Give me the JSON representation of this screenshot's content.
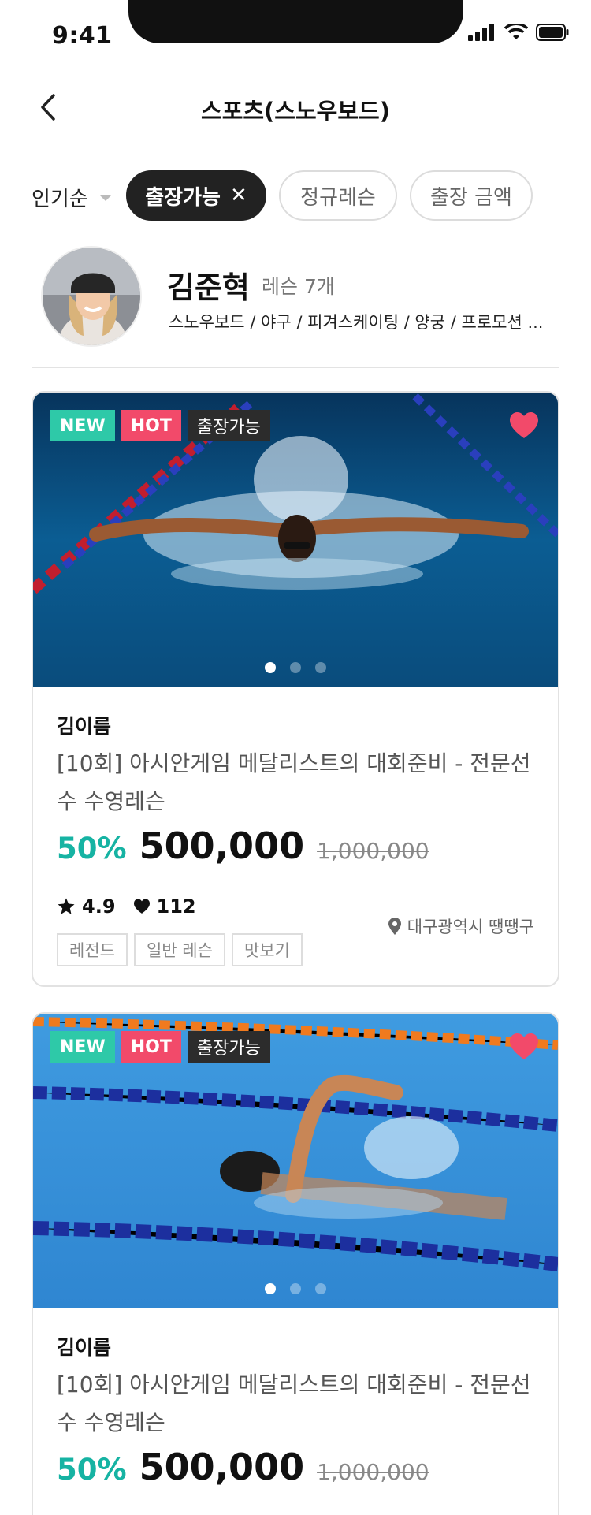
{
  "status": {
    "time": "9:41"
  },
  "header": {
    "title": "스포츠(스노우보드)"
  },
  "filters": {
    "sort_label": "인기순",
    "chips": [
      {
        "label": "출장가능",
        "active": true,
        "close": "✕"
      },
      {
        "label": "정규레슨",
        "active": false
      },
      {
        "label": "출장 금액",
        "active": false
      }
    ]
  },
  "profile": {
    "name": "김준혁",
    "lesson_count": "레슨 7개",
    "sports": "스노우보드 / 야구 / 피겨스케이팅 / 양궁 / 프로모션 ..."
  },
  "cards": [
    {
      "badges": [
        "NEW",
        "HOT",
        "출장가능"
      ],
      "favorited": true,
      "instructor": "김이름",
      "title": "[10회]  아시안게임 메달리스트의 대회준비 - 전문선수 수영레슨",
      "discount": "50%",
      "price": "500,000",
      "original_price": "1,000,000",
      "rating": "4.9",
      "likes": "112",
      "location": "대구광역시 땡땡구",
      "tags": [
        "레전드",
        "일반 레슨",
        "맛보기"
      ],
      "carousel": {
        "total": 3,
        "active": 1
      }
    },
    {
      "badges": [
        "NEW",
        "HOT",
        "출장가능"
      ],
      "favorited": true,
      "instructor": "김이름",
      "title": "[10회]  아시안게임 메달리스트의 대회준비 - 전문선수 수영레슨",
      "discount": "50%",
      "price": "500,000",
      "original_price": "1,000,000",
      "carousel": {
        "total": 3,
        "active": 1
      }
    }
  ],
  "colors": {
    "accent": "#16b3a3",
    "new_badge": "#2ec9a8",
    "hot_badge": "#f24a6a",
    "heart": "#f24a6a"
  }
}
